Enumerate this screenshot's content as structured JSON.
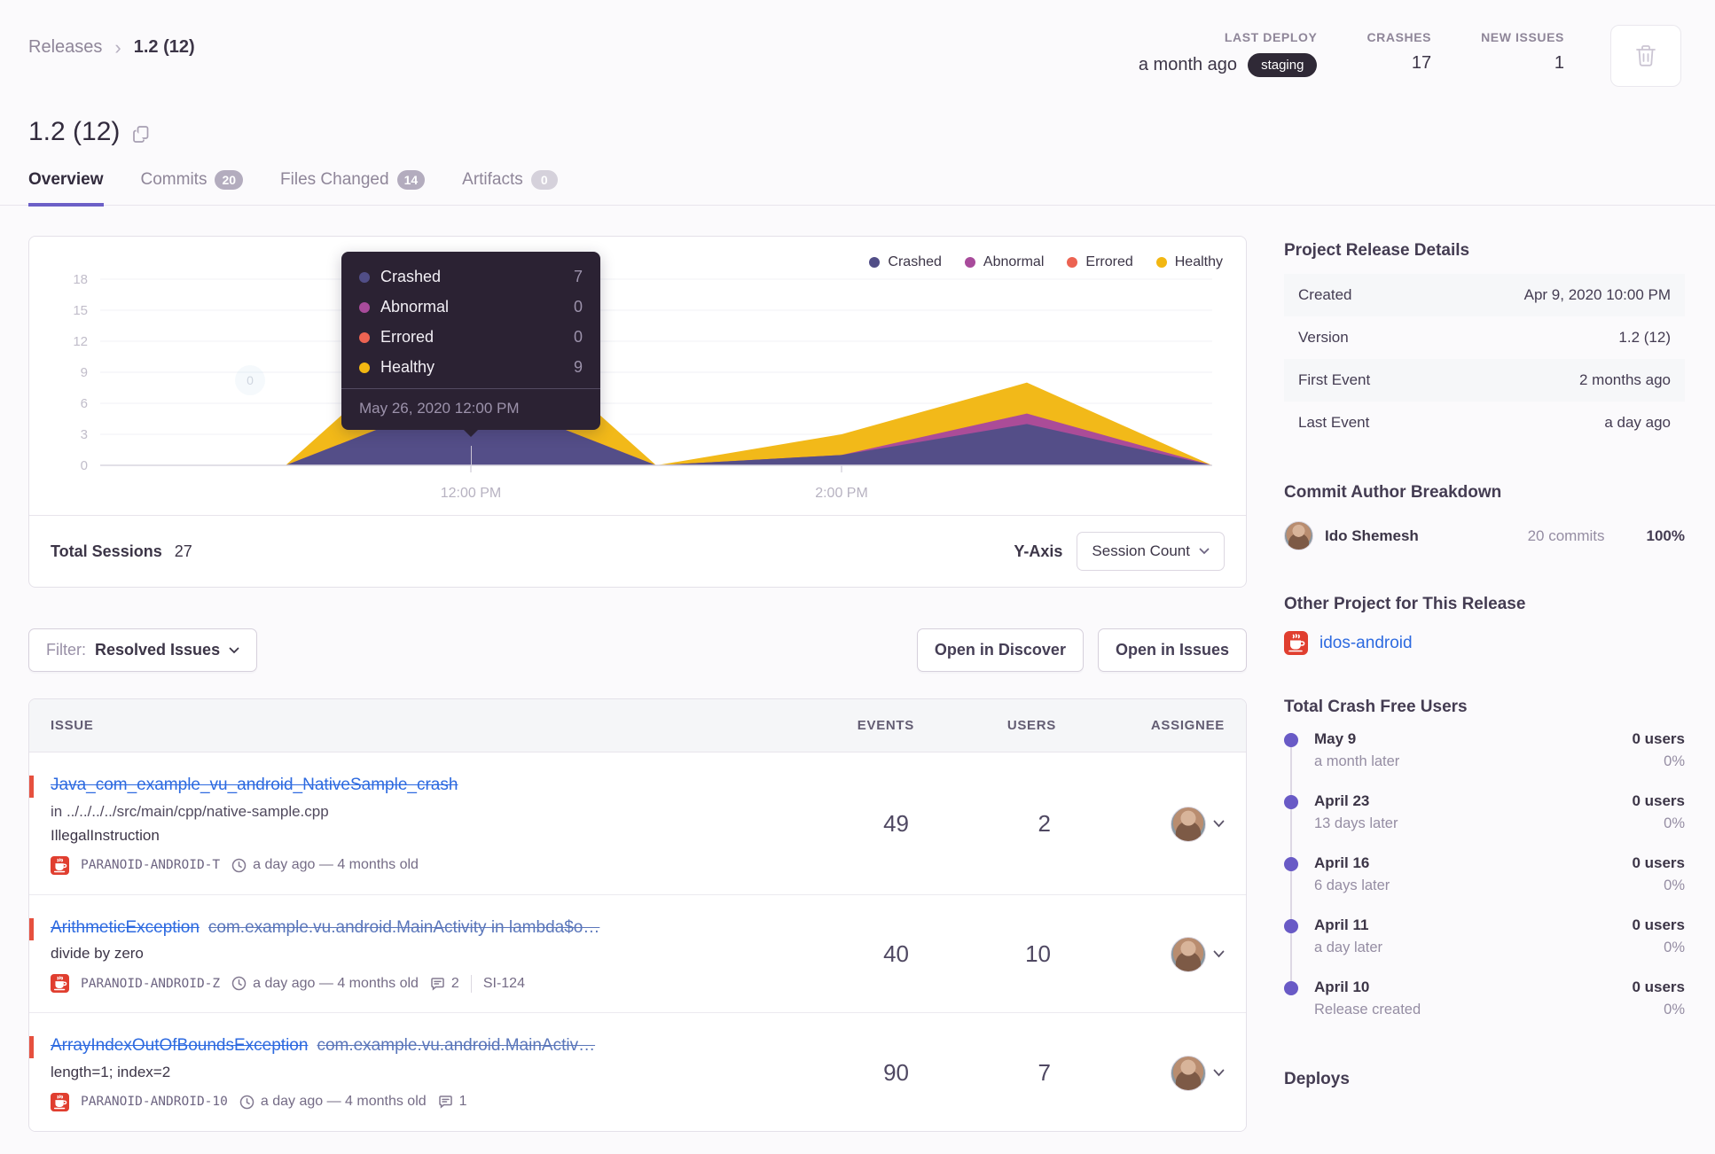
{
  "breadcrumb": {
    "parent": "Releases",
    "current": "1.2 (12)"
  },
  "header_stats": {
    "last_deploy": {
      "label": "LAST DEPLOY",
      "value": "a month ago",
      "env": "staging"
    },
    "crashes": {
      "label": "CRASHES",
      "value": "17"
    },
    "new_issues": {
      "label": "NEW ISSUES",
      "value": "1"
    }
  },
  "page": {
    "title": "1.2 (12)"
  },
  "tabs": [
    {
      "label": "Overview",
      "badge": null,
      "active": true
    },
    {
      "label": "Commits",
      "badge": "20",
      "active": false
    },
    {
      "label": "Files Changed",
      "badge": "14",
      "active": false
    },
    {
      "label": "Artifacts",
      "badge": "0",
      "active": false
    }
  ],
  "chart_data": {
    "type": "area",
    "stacked": true,
    "x": [
      "10:00 AM",
      "11:00 AM",
      "12:00 PM",
      "1:00 PM",
      "2:00 PM",
      "3:00 PM",
      "4:00 PM"
    ],
    "x_tick_labels": [
      "12:00 PM",
      "2:00 PM"
    ],
    "x_tick_indices": [
      2,
      4
    ],
    "series": [
      {
        "name": "Crashed",
        "color": "#514e87",
        "values": [
          0,
          0,
          7,
          0,
          1,
          4,
          0
        ]
      },
      {
        "name": "Abnormal",
        "color": "#a84b9b",
        "values": [
          0,
          0,
          0,
          0,
          0,
          1,
          0
        ]
      },
      {
        "name": "Errored",
        "color": "#ec6352",
        "values": [
          0,
          0,
          0,
          0,
          0,
          0,
          0
        ]
      },
      {
        "name": "Healthy",
        "color": "#f2b712",
        "values": [
          0,
          0,
          9,
          0,
          2,
          3,
          0
        ]
      }
    ],
    "ylim": [
      0,
      18
    ],
    "y_ticks": [
      0,
      3,
      6,
      9,
      12,
      15,
      18
    ],
    "title": "",
    "xlabel": "",
    "ylabel": "Session Count",
    "legend_position": "top-right",
    "grid": true
  },
  "chart": {
    "tooltip": {
      "rows": [
        {
          "label": "Crashed",
          "value": "7",
          "color": "#514e87"
        },
        {
          "label": "Abnormal",
          "value": "0",
          "color": "#a84b9b"
        },
        {
          "label": "Errored",
          "value": "0",
          "color": "#ec6352"
        },
        {
          "label": "Healthy",
          "value": "9",
          "color": "#f2b712"
        }
      ],
      "timestamp": "May 26, 2020 12:00 PM"
    },
    "footer": {
      "total_label": "Total Sessions",
      "total_value": "27",
      "yaxis_label": "Y-Axis",
      "yaxis_value": "Session Count"
    }
  },
  "toolbar": {
    "filter_label": "Filter:",
    "filter_value": "Resolved Issues",
    "discover_button": "Open in Discover",
    "issues_button": "Open in Issues"
  },
  "issues_table": {
    "columns": [
      "ISSUE",
      "EVENTS",
      "USERS",
      "ASSIGNEE"
    ],
    "rows": [
      {
        "title": "Java_com_example_vu_android_NativeSample_crash",
        "culprit": null,
        "subtitle": "in ../../../../src/main/cpp/native-sample.cpp",
        "message": "IllegalInstruction",
        "project": "PARANOID-ANDROID-T",
        "age": "a day ago — 4 months old",
        "comments": null,
        "short_id": null,
        "events": "49",
        "users": "2"
      },
      {
        "title": "ArithmeticException",
        "culprit": "com.example.vu.android.MainActivity in lambda$o…",
        "subtitle": null,
        "message": "divide by zero",
        "project": "PARANOID-ANDROID-Z",
        "age": "a day ago — 4 months old",
        "comments": "2",
        "short_id": "SI-124",
        "events": "40",
        "users": "10"
      },
      {
        "title": "ArrayIndexOutOfBoundsException",
        "culprit": "com.example.vu.android.MainActiv…",
        "subtitle": null,
        "message": "length=1; index=2",
        "project": "PARANOID-ANDROID-10",
        "age": "a day ago — 4 months old",
        "comments": "1",
        "short_id": null,
        "events": "90",
        "users": "7"
      }
    ]
  },
  "sidebar": {
    "details": {
      "heading": "Project Release Details",
      "rows": [
        {
          "label": "Created",
          "value": "Apr 9, 2020 10:00 PM"
        },
        {
          "label": "Version",
          "value": "1.2 (12)"
        },
        {
          "label": "First Event",
          "value": "2 months ago"
        },
        {
          "label": "Last Event",
          "value": "a day ago"
        }
      ]
    },
    "authors": {
      "heading": "Commit Author Breakdown",
      "name": "Ido Shemesh",
      "commits": "20 commits",
      "percent": "100%"
    },
    "other_project": {
      "heading": "Other Project for This Release",
      "name": "idos-android"
    },
    "crash_free": {
      "heading": "Total Crash Free Users",
      "items": [
        {
          "date": "May 9",
          "sub": "a month later",
          "users": "0 users",
          "pct": "0%"
        },
        {
          "date": "April 23",
          "sub": "13 days later",
          "users": "0 users",
          "pct": "0%"
        },
        {
          "date": "April 16",
          "sub": "6 days later",
          "users": "0 users",
          "pct": "0%"
        },
        {
          "date": "April 11",
          "sub": "a day later",
          "users": "0 users",
          "pct": "0%"
        },
        {
          "date": "April 10",
          "sub": "Release created",
          "users": "0 users",
          "pct": "0%"
        }
      ]
    },
    "deploys_heading": "Deploys"
  },
  "colors": {
    "accent_purple": "#6c5fc7",
    "link_blue": "#2d6ae0",
    "alert_red": "#e6503e",
    "pill_dark": "#2f2936"
  }
}
